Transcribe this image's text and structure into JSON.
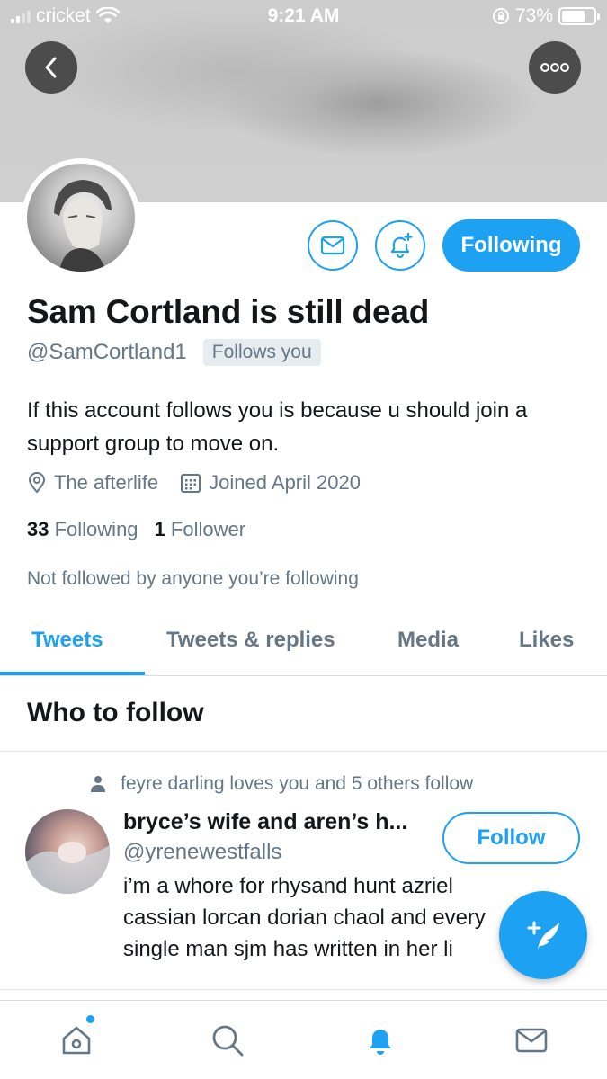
{
  "status_bar": {
    "carrier": "cricket",
    "time": "9:21 AM",
    "battery": "73%",
    "battery_level": 0.73
  },
  "profile": {
    "display_name": "Sam Cortland is still dead",
    "handle": "@SamCortland1",
    "follows_you_badge": "Follows you",
    "bio": "If this account follows you is because u should join a support group to move on.",
    "location": "The afterlife",
    "joined": "Joined April 2020",
    "following_count": "33",
    "following_label": "Following",
    "followers_count": "1",
    "followers_label": "Follower",
    "social_context": "Not followed by anyone you’re following",
    "following_button": "Following"
  },
  "tabs": [
    {
      "label": "Tweets",
      "active": true
    },
    {
      "label": "Tweets & replies",
      "active": false
    },
    {
      "label": "Media",
      "active": false
    },
    {
      "label": "Likes",
      "active": false
    }
  ],
  "who_to_follow": {
    "title": "Who to follow",
    "suggestion": {
      "context": "feyre darling loves you and 5 others follow",
      "name": "bryce’s wife and aren’s h...",
      "handle": "@yrenewestfalls",
      "bio": "i’m a whore for rhysand hunt azriel cassian lorcan dorian chaol and every single man sjm has written in her li",
      "follow_button": "Follow"
    }
  },
  "icons": {
    "back": "chevron-left-icon",
    "more": "more-icon",
    "mail": "mail-icon",
    "notify": "bell-plus-icon",
    "location": "location-pin-icon",
    "calendar": "calendar-icon",
    "compose": "compose-tweet-icon",
    "home": "home-icon",
    "search": "search-icon",
    "notifications": "bell-icon",
    "messages": "mail-icon"
  },
  "colors": {
    "accent": "#1da1f2",
    "secondary_text": "#657786",
    "primary_text": "#14171a"
  }
}
